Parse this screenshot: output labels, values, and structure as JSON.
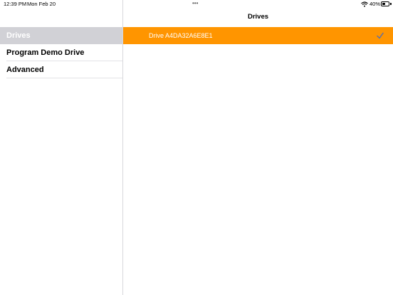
{
  "status_bar": {
    "time": "12:39 PM",
    "date": "Mon Feb 20",
    "battery_percent": "40%",
    "battery_level": 0.4
  },
  "sidebar": {
    "items": [
      {
        "label": "Drives",
        "selected": true
      },
      {
        "label": "Program Demo Drive",
        "selected": false
      },
      {
        "label": "Advanced",
        "selected": false
      }
    ]
  },
  "main": {
    "title": "Drives",
    "drives": [
      {
        "label": "Drive  A4DA32A6E8E1",
        "selected": true
      }
    ]
  },
  "colors": {
    "accent": "#ff9500",
    "selected_sidebar": "#d1d1d6",
    "checkmark": "#5b6fa8"
  }
}
